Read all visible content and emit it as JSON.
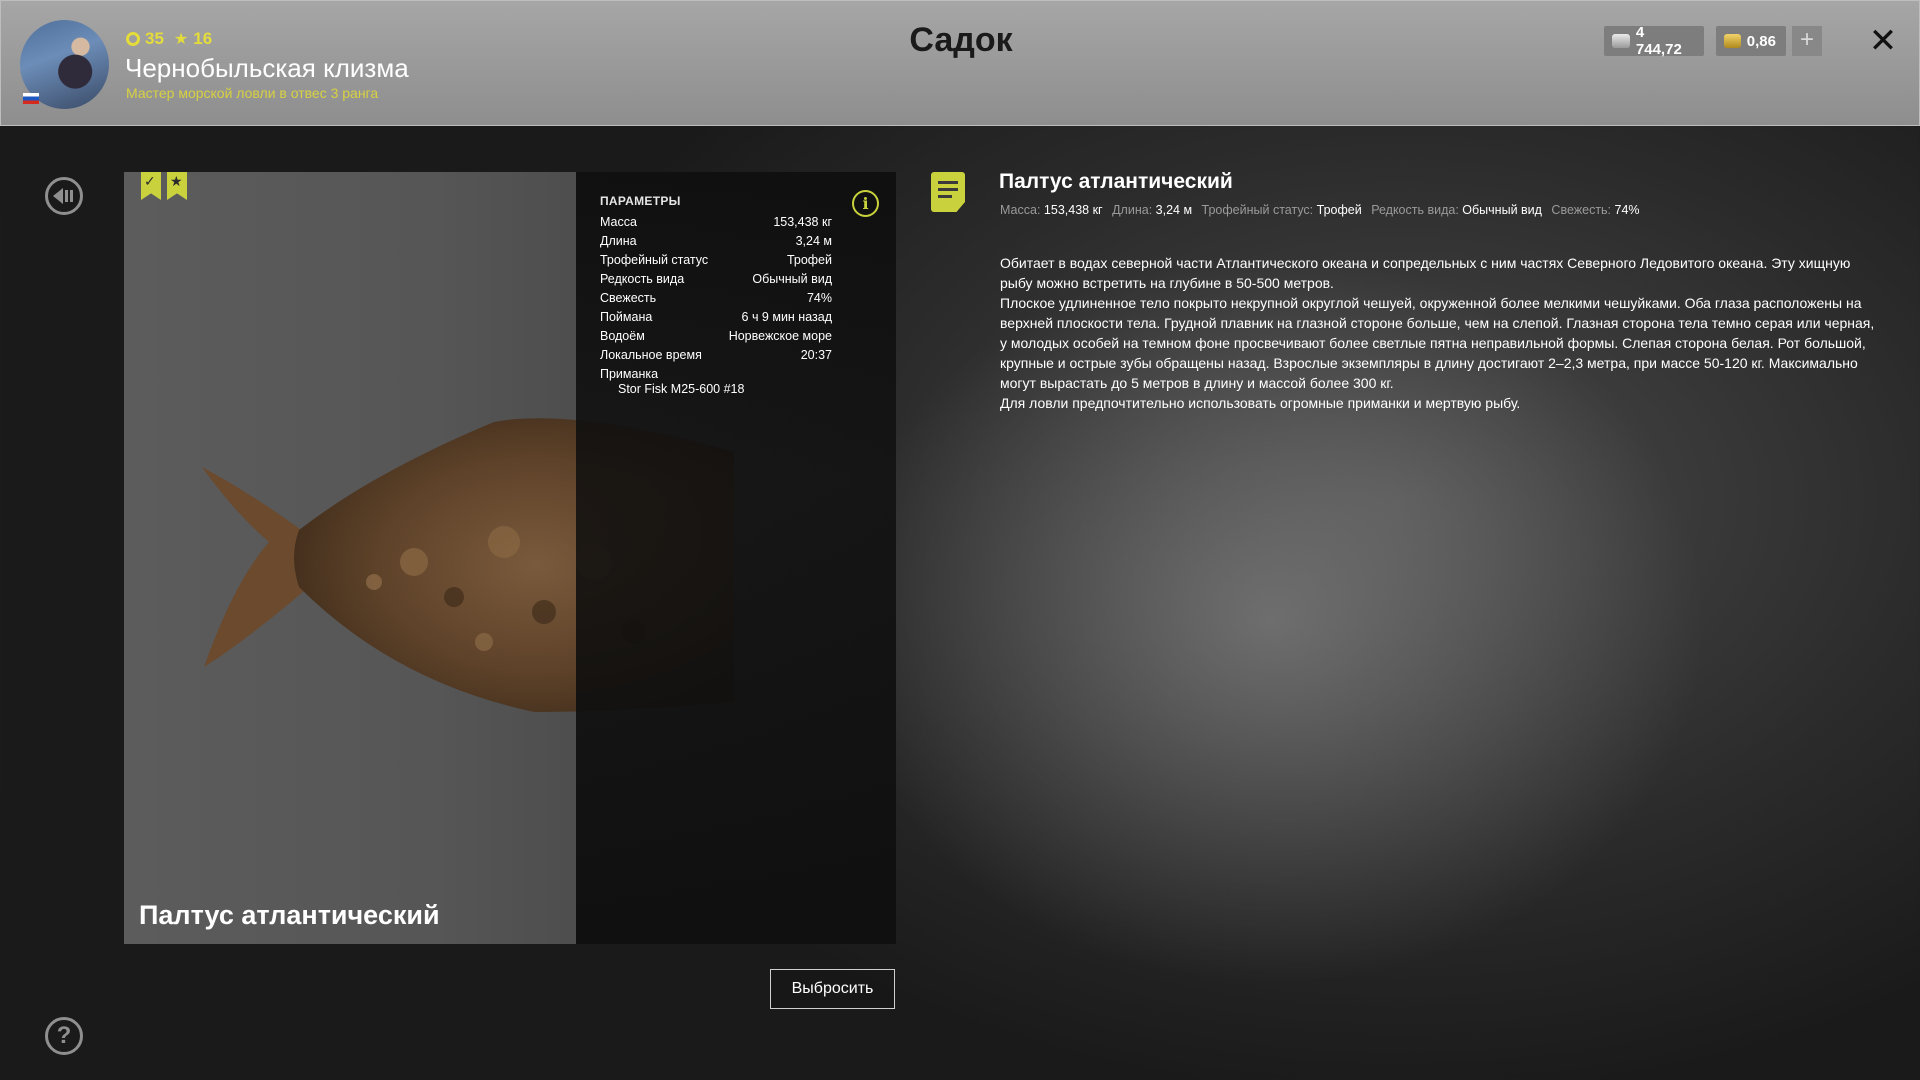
{
  "header": {
    "title": "Садок",
    "player": {
      "level": "35",
      "rank": "16",
      "name": "Чернобыльская клизма",
      "title": "Мастер морской ловли в отвес 3 ранга"
    },
    "currency": {
      "silver": "4 744,72",
      "gold": "0,86",
      "add_label": "+"
    },
    "close_label": "✕"
  },
  "fish": {
    "name": "Палтус атлантический",
    "params_heading": "ПАРАМЕТРЫ",
    "params": [
      {
        "label": "Масса",
        "value": "153,438 кг"
      },
      {
        "label": "Длина",
        "value": "3,24 м"
      },
      {
        "label": "Трофейный статус",
        "value": "Трофей"
      },
      {
        "label": "Редкость вида",
        "value": "Обычный вид"
      },
      {
        "label": "Свежесть",
        "value": "74%"
      },
      {
        "label": "Поймана",
        "value": "6 ч 9 мин назад"
      },
      {
        "label": "Водоём",
        "value": "Норвежское море"
      },
      {
        "label": "Локальное время",
        "value": "20:37"
      }
    ],
    "lure_label": "Приманка",
    "lure_value": "Stor Fisk M25-600 #18"
  },
  "actions": {
    "discard_label": "Выбросить"
  },
  "description": {
    "title": "Палтус атлантический",
    "stats": [
      {
        "label": "Масса:",
        "value": "153,438 кг"
      },
      {
        "label": "Длина:",
        "value": "3,24 м"
      },
      {
        "label": "Трофейный статус:",
        "value": "Трофей"
      },
      {
        "label": "Редкость вида:",
        "value": "Обычный вид"
      },
      {
        "label": "Свежесть:",
        "value": "74%"
      }
    ],
    "paragraphs": [
      "Обитает в водах северной части Атлантического океана и сопредельных с ним частях Северного Ледовитого океана. Эту хищную рыбу можно встретить на глубине в 50-500 метров.",
      "Плоское удлиненное тело покрыто некрупной округлой чешуей, окруженной более мелкими чешуйками. Оба глаза расположены на верхней плоскости тела. Грудной плавник на глазной стороне больше, чем на слепой. Глазная сторона тела темно серая или черная, у молодых особей на темном фоне просвечивают более светлые пятна неправильной формы. Слепая сторона белая. Рот большой, крупные и острые зубы обращены назад. Взрослые экземпляры в длину достигают 2–2,3 метра, при массе 50-120 кг. Максимально могут вырастать до 5 метров в длину и массой более 300 кг.",
      "Для ловли предпочтительно использовать огромные приманки и мертвую рыбу."
    ]
  },
  "help_label": "?",
  "colors": {
    "accent": "#c9d23d",
    "header_bg": "#9a9a9a",
    "panel_bg": "#0e0e0e"
  }
}
